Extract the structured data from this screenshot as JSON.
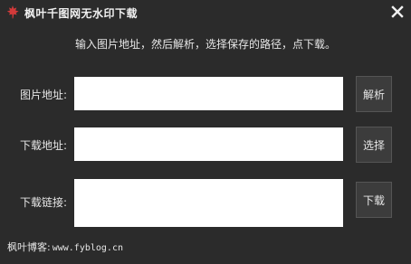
{
  "window": {
    "title": "枫叶千图网无水印下载",
    "icon": "maple-leaf-icon",
    "close": "close-icon"
  },
  "instruction": "输入图片地址，然后解析，选择保存的路径，点下载。",
  "rows": {
    "image_url": {
      "label": "图片地址:",
      "value": "",
      "button": "解析"
    },
    "save_path": {
      "label": "下载地址:",
      "value": "",
      "button": "选择"
    },
    "download_link": {
      "label": "下载链接:",
      "value": "",
      "button": "下载"
    }
  },
  "footer": {
    "label": "枫叶博客:",
    "link": "www.fyblog.cn"
  },
  "colors": {
    "background": "#2b2b2b",
    "field": "#ffffff",
    "button": "#3c3c3c",
    "icon": "#d23a3a"
  }
}
